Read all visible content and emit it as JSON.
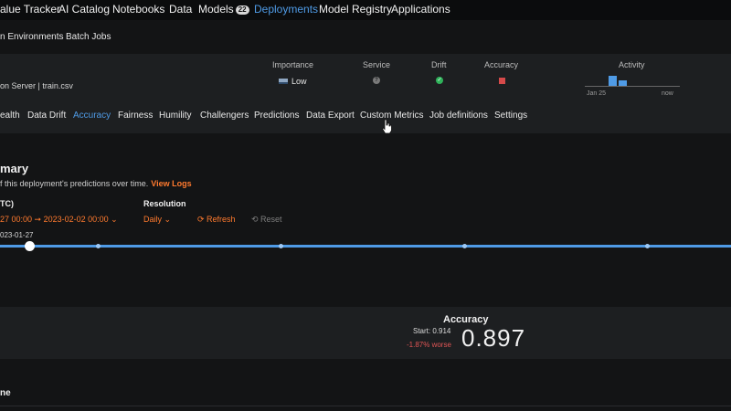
{
  "topnav": {
    "items": [
      "alue Tracker",
      "AI Catalog",
      "Notebooks",
      "Data",
      "Models",
      "Deployments",
      "Model Registry",
      "Applications"
    ],
    "models_badge": "22"
  },
  "subnav": {
    "items": [
      "n Environments",
      "Batch Jobs"
    ]
  },
  "summary": {
    "dataset": "on Server | train.csv",
    "headers": {
      "importance": "Importance",
      "service": "Service",
      "drift": "Drift",
      "accuracy": "Accuracy",
      "activity": "Activity"
    },
    "importance_value": "Low",
    "service_icon": "?",
    "drift_icon": "✓",
    "activity_ticks": [
      "Jan 25",
      "now"
    ],
    "colors": {
      "accent": "#4f9be6",
      "ok": "#2fb35a",
      "bad": "#d64a4a",
      "warn_text": "#ff7a2e"
    }
  },
  "tabs": [
    "ealth",
    "Data Drift",
    "Accuracy",
    "Fairness",
    "Humility",
    "Challengers",
    "Predictions",
    "Data Export",
    "Custom Metrics",
    "Job definitions",
    "Settings"
  ],
  "section": {
    "title": "mary",
    "description": "f this deployment's predictions over time.",
    "view_logs": "View Logs"
  },
  "controls": {
    "range_label": "TC)",
    "range_value": "27  00:00 ➞ 2023-02-02  00:00 ⌄",
    "resolution_label": "Resolution",
    "resolution_value": "Daily ⌄",
    "refresh": "⟳ Refresh",
    "reset": "⟲ Reset",
    "slider_start": "023-01-27"
  },
  "metric": {
    "name": "Accuracy",
    "start": "Start: 0.914",
    "change": "-1.87% worse",
    "value": "0.897"
  },
  "bottom": {
    "label": "ne"
  }
}
